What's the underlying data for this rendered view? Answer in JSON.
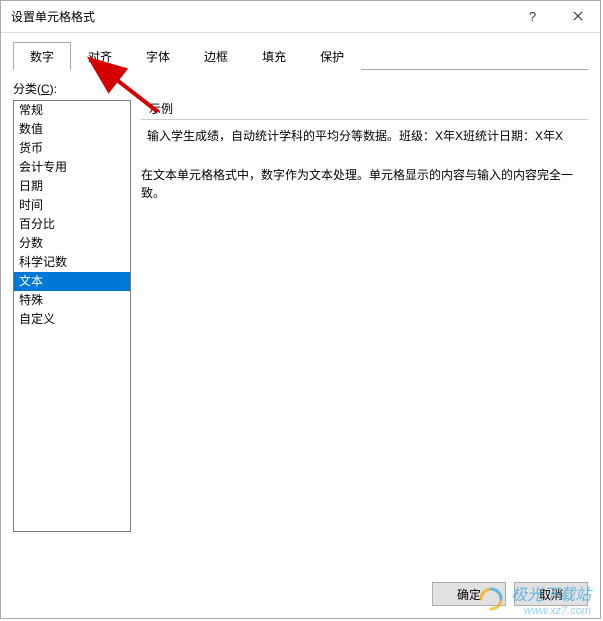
{
  "titlebar": {
    "title": "设置单元格格式"
  },
  "tabs": {
    "items": [
      {
        "label": "数字"
      },
      {
        "label": "对齐"
      },
      {
        "label": "字体"
      },
      {
        "label": "边框"
      },
      {
        "label": "填充"
      },
      {
        "label": "保护"
      }
    ],
    "active_index": 0
  },
  "category": {
    "label_prefix": "分类(",
    "label_underline": "C",
    "label_suffix": "):",
    "items": [
      "常规",
      "数值",
      "货币",
      "会计专用",
      "日期",
      "时间",
      "百分比",
      "分数",
      "科学记数",
      "文本",
      "特殊",
      "自定义"
    ],
    "selected_index": 9
  },
  "example": {
    "label": "示例",
    "value": "输入学生成绩，自动统计学科的平均分等数据。班级：X年X班统计日期：X年X"
  },
  "description": "在文本单元格格式中，数字作为文本处理。单元格显示的内容与输入的内容完全一致。",
  "buttons": {
    "ok": "确定",
    "cancel": "取消"
  },
  "watermark": {
    "main": "极光下载站",
    "sub": "www.xz7.com"
  }
}
